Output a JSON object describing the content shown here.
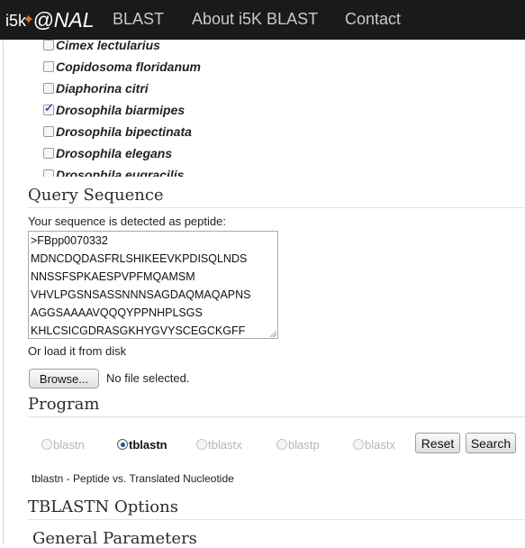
{
  "navbar": {
    "brand_i5k": "i5k",
    "brand_nal": "@NAL",
    "links": [
      "BLAST",
      "About i5K BLAST",
      "Contact"
    ]
  },
  "organisms": [
    {
      "name": "Cimex lectularius",
      "checked": false
    },
    {
      "name": "Copidosoma floridanum",
      "checked": false
    },
    {
      "name": "Diaphorina citri",
      "checked": false
    },
    {
      "name": "Drosophila biarmipes",
      "checked": true
    },
    {
      "name": "Drosophila bipectinata",
      "checked": false
    },
    {
      "name": "Drosophila elegans",
      "checked": false
    },
    {
      "name": "Drosophila eugracilis",
      "checked": false
    }
  ],
  "query": {
    "title": "Query Sequence",
    "detected_text": "Your sequence is detected as peptide:",
    "sequence_lines": [
      ">FBpp0070332",
      "MDNCDQDASFRLSHIKEEVKPDISQLNDS",
      "NNSSFSPKAESPVPFMQAMSM",
      "VHVLPGSNSASSNNNSAGDAQMAQAPNS",
      "AGGSAAAAVQQQYPPNHPLSGS",
      "KHLCSICGDRASGKHYGVYSCEGCKGFF"
    ],
    "load_text": "Or load it from disk",
    "browse_label": "Browse...",
    "no_file_text": "No file selected."
  },
  "program": {
    "title": "Program",
    "options": [
      {
        "label": "blastn",
        "selected": false
      },
      {
        "label": "tblastn",
        "selected": true
      },
      {
        "label": "tblastx",
        "selected": false
      },
      {
        "label": "blastp",
        "selected": false
      },
      {
        "label": "blastx",
        "selected": false
      }
    ],
    "reset_label": "Reset",
    "search_label": "Search",
    "description": "tblastn - Peptide vs. Translated Nucleotide"
  },
  "options_title": "TBLASTN Options",
  "general_title": "General Parameters"
}
